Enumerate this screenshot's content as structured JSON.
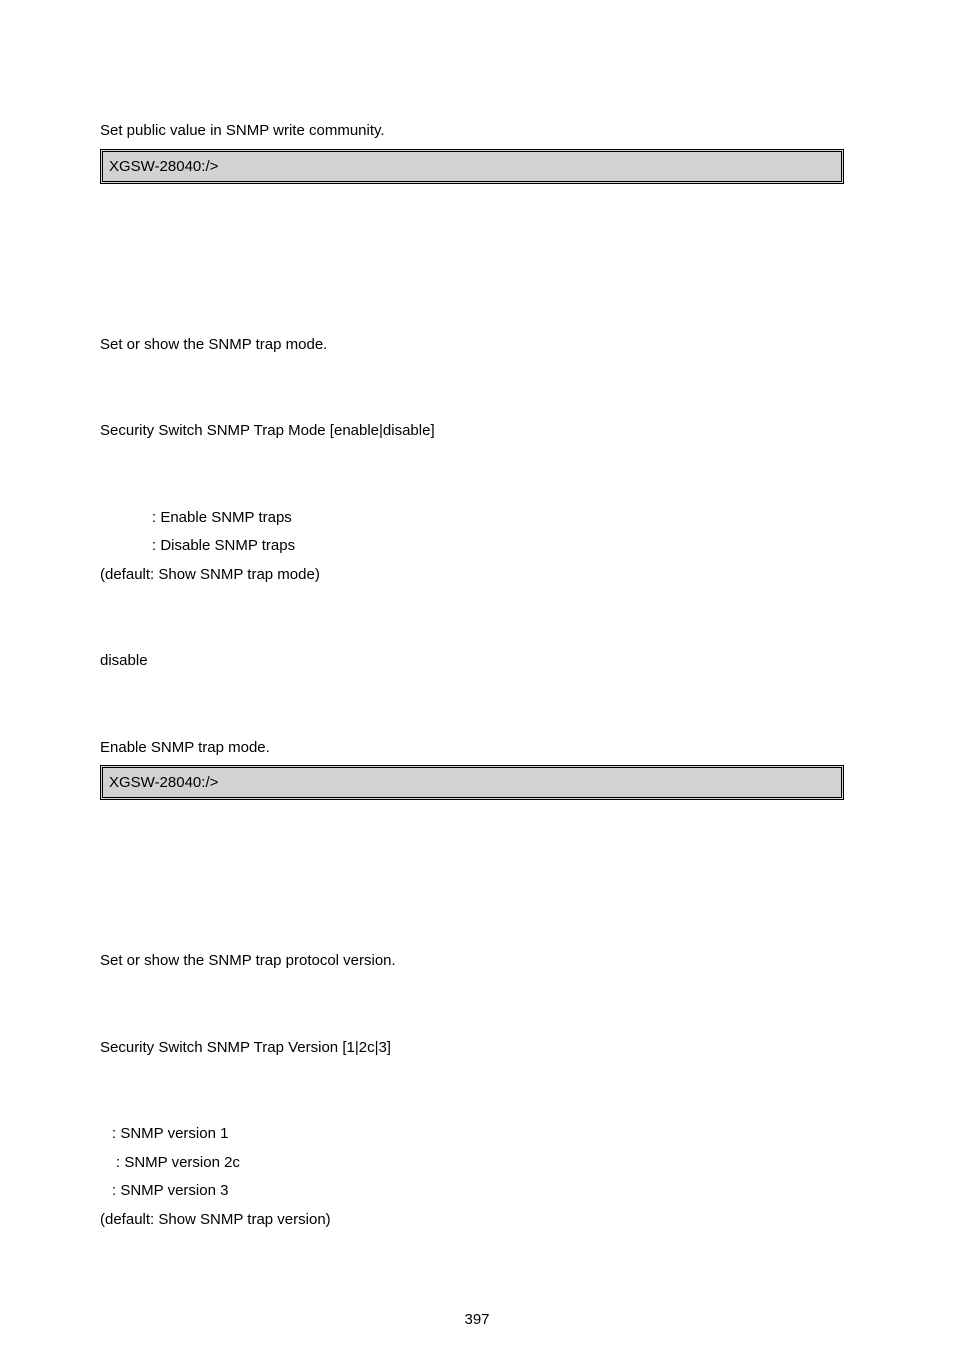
{
  "section1": {
    "intro": "Set public value in SNMP write community.",
    "code": "XGSW-28040:/>"
  },
  "section2": {
    "desc": "Set or show the SNMP trap mode.",
    "syntax": "Security Switch SNMP Trap Mode [enable|disable]",
    "param1": ": Enable SNMP traps",
    "param2": ": Disable SNMP traps",
    "param3": "(default: Show SNMP trap mode)",
    "default": "disable",
    "example_intro": "Enable SNMP trap mode.",
    "code": "XGSW-28040:/>"
  },
  "section3": {
    "desc": "Set or show the SNMP trap protocol version.",
    "syntax": "Security Switch SNMP Trap Version [1|2c|3]",
    "p1": ": SNMP version 1",
    "p2": ": SNMP version 2c",
    "p3": ": SNMP version 3",
    "p4": "(default: Show SNMP trap version)"
  },
  "page_number": "397"
}
